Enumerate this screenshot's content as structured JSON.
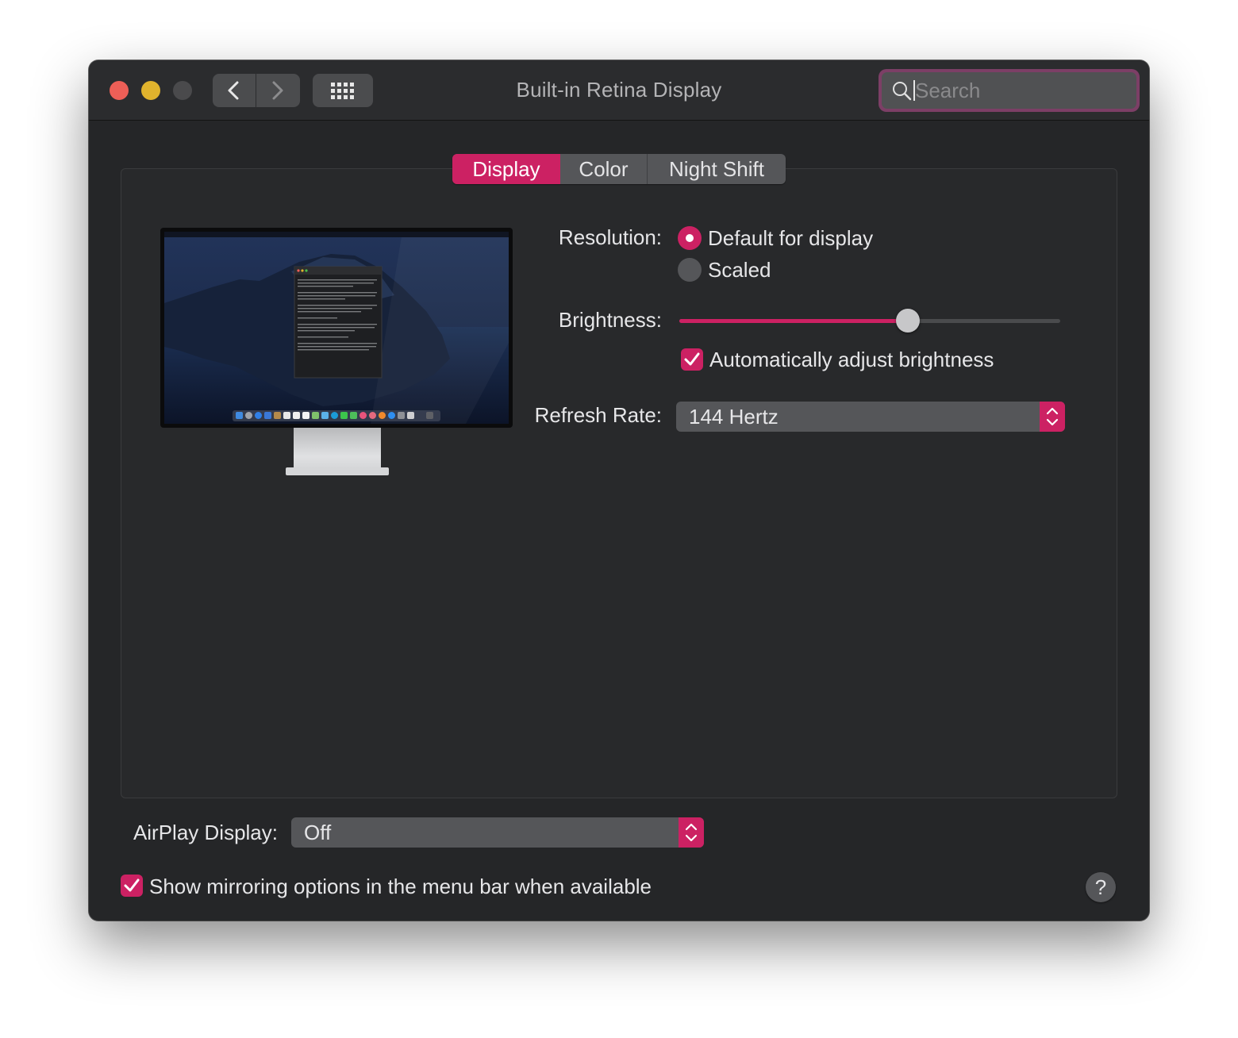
{
  "window": {
    "title": "Built-in Retina Display"
  },
  "toolbar": {
    "back_icon": "chevron-left-icon",
    "forward_icon": "chevron-right-icon",
    "show_all_icon": "grid-icon"
  },
  "search": {
    "placeholder": "Search",
    "value": "",
    "icon": "search-icon"
  },
  "tabs": [
    {
      "label": "Display",
      "selected": true
    },
    {
      "label": "Color",
      "selected": false
    },
    {
      "label": "Night Shift",
      "selected": false
    }
  ],
  "display": {
    "resolution_label": "Resolution:",
    "resolution_options": [
      {
        "label": "Default for display",
        "selected": true
      },
      {
        "label": "Scaled",
        "selected": false
      }
    ],
    "brightness_label": "Brightness:",
    "brightness_level": 0.6,
    "auto_brightness_label": "Automatically adjust brightness",
    "auto_brightness_checked": true,
    "refresh_rate_label": "Refresh Rate:",
    "refresh_rate_value": "144 Hertz"
  },
  "airplay": {
    "label": "AirPlay Display:",
    "value": "Off"
  },
  "mirroring": {
    "label": "Show mirroring options in the menu bar when available",
    "checked": true
  },
  "help": {
    "label": "?"
  },
  "colors": {
    "accent": "#cc2163",
    "window_bg": "#252628",
    "control_bg": "#555659"
  }
}
